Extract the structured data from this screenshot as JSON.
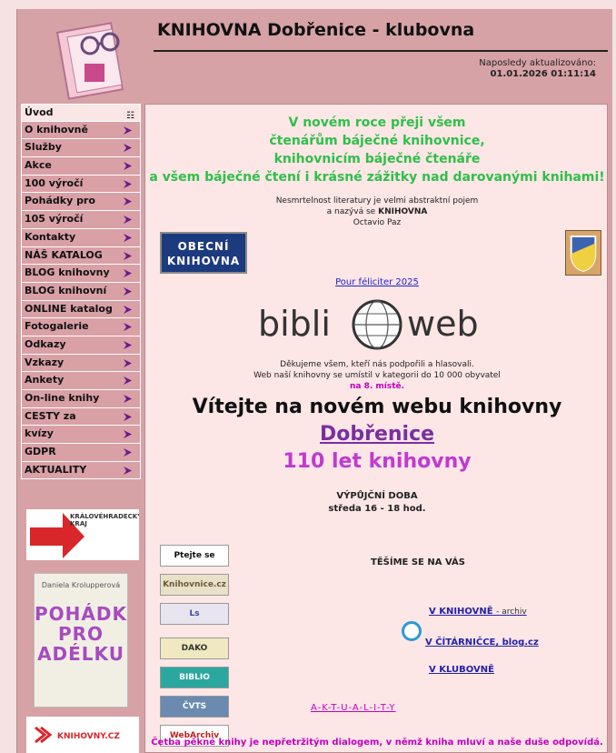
{
  "header": {
    "title": "KNIHOVNA Dobřenice - klubovna",
    "update_label": "Naposledy aktualizováno:",
    "update_value": "01.01.2026 01:11:14"
  },
  "nav": {
    "items": [
      {
        "label": "Úvod"
      },
      {
        "label": "O knihovně"
      },
      {
        "label": "Služby"
      },
      {
        "label": "Akce"
      },
      {
        "label": "100 výročí"
      },
      {
        "label": "Pohádky pro"
      },
      {
        "label": "105 výročí"
      },
      {
        "label": "Kontakty"
      },
      {
        "label": "NÁŠ KATALOG"
      },
      {
        "label": "BLOG knihovny"
      },
      {
        "label": "BLOG knihovní"
      },
      {
        "label": "ONLINE katalog"
      },
      {
        "label": "Fotogalerie"
      },
      {
        "label": "Odkazy"
      },
      {
        "label": "Vzkazy"
      },
      {
        "label": "Ankety"
      },
      {
        "label": "On-line knihy"
      },
      {
        "label": "CESTY za"
      },
      {
        "label": "kvízy"
      },
      {
        "label": "GDPR"
      },
      {
        "label": "AKTUALITY"
      }
    ]
  },
  "banners": {
    "kralovehradecky": "KRÁLOVÉHRADECKÝ KRAJ",
    "book_author": "Daniela Krolupperová",
    "book_title": "POHÁDKY PRO ADÉLKU",
    "knihovny": "KNIHOVNY.CZ"
  },
  "main": {
    "greeting": [
      "V novém roce přeji všem",
      "čtenářům báječné knihovnice,",
      "knihovnicím báječné čtenáře",
      "a všem báječné čtení i krásné zážitky nad darovanými knihami!"
    ],
    "quote_line1": "Nesmrtelnost literatury je velmi abstraktní pojem",
    "quote_line2_prefix": "a nazývá se",
    "quote_line2_bold": "KNIHOVNA",
    "quote_author": "Octavio Paz",
    "obecni_line1": "OBECNÍ",
    "obecni_line2": "KNIHOVNA",
    "pf_link": "Pour féliciter 2025",
    "biblioweb_left": "bibli",
    "biblioweb_right": "web",
    "thanks_line1": "Děkujeme všem, kteří nás podpořili a hlasovali.",
    "thanks_line2": "Web naší knihovny se umístil v kategorii do 10 000 obyvatel",
    "thanks_place": "na 8. místě.",
    "welcome": "Vítejte na novém webu knihovny",
    "town": "Dobřenice",
    "years": "110 let knihovny",
    "hours_title": "VÝPŮJČNÍ DOBA",
    "hours_value": "středa 16 - 18 hod.",
    "see_you": "TĚŠÍME SE NA VÁS",
    "loc_library": "V KNIHOVNĚ",
    "loc_library_note": "- archiv",
    "loc_reading": "V ČÍTÁRNIČCE, blog.cz",
    "loc_club": "V KLUBOVNĚ",
    "aktuality": "A-K-T-U-A-L-I-T-Y",
    "footer_quote": "Četba pěkné knihy je nepřetržitým dialogem, v němž kniha mluví a naše duše odpovídá."
  },
  "badges": [
    "Ptejte se knihovny",
    "Knihovnicе.cz",
    "Ls",
    "DAKO",
    "BIBLIO HELP.cz",
    "ČVTS",
    "WebArchiv"
  ],
  "colors": {
    "frame": "#d6a2a6",
    "content_bg": "#fde6e6",
    "green_text": "#2fbf4a",
    "magenta": "#c000c0",
    "link_blue": "#2222cc"
  }
}
